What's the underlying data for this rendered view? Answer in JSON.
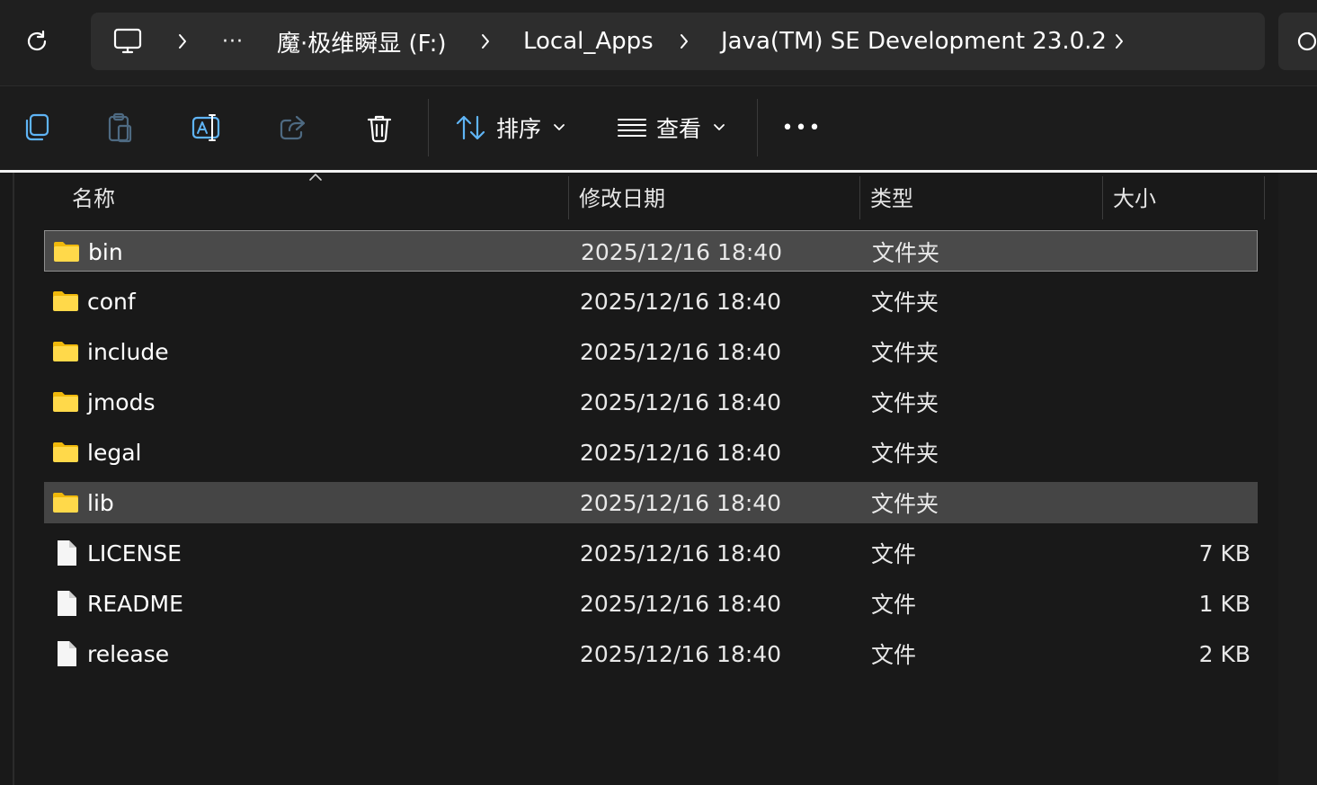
{
  "breadcrumb": {
    "overflow": "···",
    "items": [
      "魔·极维瞬显 (F:)",
      "Local_Apps",
      "Java(TM) SE Development 23.0.2"
    ]
  },
  "toolbar": {
    "sort_label": "排序",
    "view_label": "查看",
    "more_label": "•••"
  },
  "columns": {
    "name": "名称",
    "modified": "修改日期",
    "type": "类型",
    "size": "大小"
  },
  "files": [
    {
      "name": "bin",
      "modified": "2025/12/16 18:40",
      "type": "文件夹",
      "size": "",
      "kind": "folder"
    },
    {
      "name": "conf",
      "modified": "2025/12/16 18:40",
      "type": "文件夹",
      "size": "",
      "kind": "folder"
    },
    {
      "name": "include",
      "modified": "2025/12/16 18:40",
      "type": "文件夹",
      "size": "",
      "kind": "folder"
    },
    {
      "name": "jmods",
      "modified": "2025/12/16 18:40",
      "type": "文件夹",
      "size": "",
      "kind": "folder"
    },
    {
      "name": "legal",
      "modified": "2025/12/16 18:40",
      "type": "文件夹",
      "size": "",
      "kind": "folder"
    },
    {
      "name": "lib",
      "modified": "2025/12/16 18:40",
      "type": "文件夹",
      "size": "",
      "kind": "folder"
    },
    {
      "name": "LICENSE",
      "modified": "2025/12/16 18:40",
      "type": "文件",
      "size": "7 KB",
      "kind": "file"
    },
    {
      "name": "README",
      "modified": "2025/12/16 18:40",
      "type": "文件",
      "size": "1 KB",
      "kind": "file"
    },
    {
      "name": "release",
      "modified": "2025/12/16 18:40",
      "type": "文件",
      "size": "2 KB",
      "kind": "file"
    }
  ],
  "colors": {
    "folder": "#ffd94a",
    "folder_dark": "#f0b90b",
    "file": "#f5f5f5",
    "selected_bg": "#4a4a4a",
    "hover_bg": "#454545"
  }
}
